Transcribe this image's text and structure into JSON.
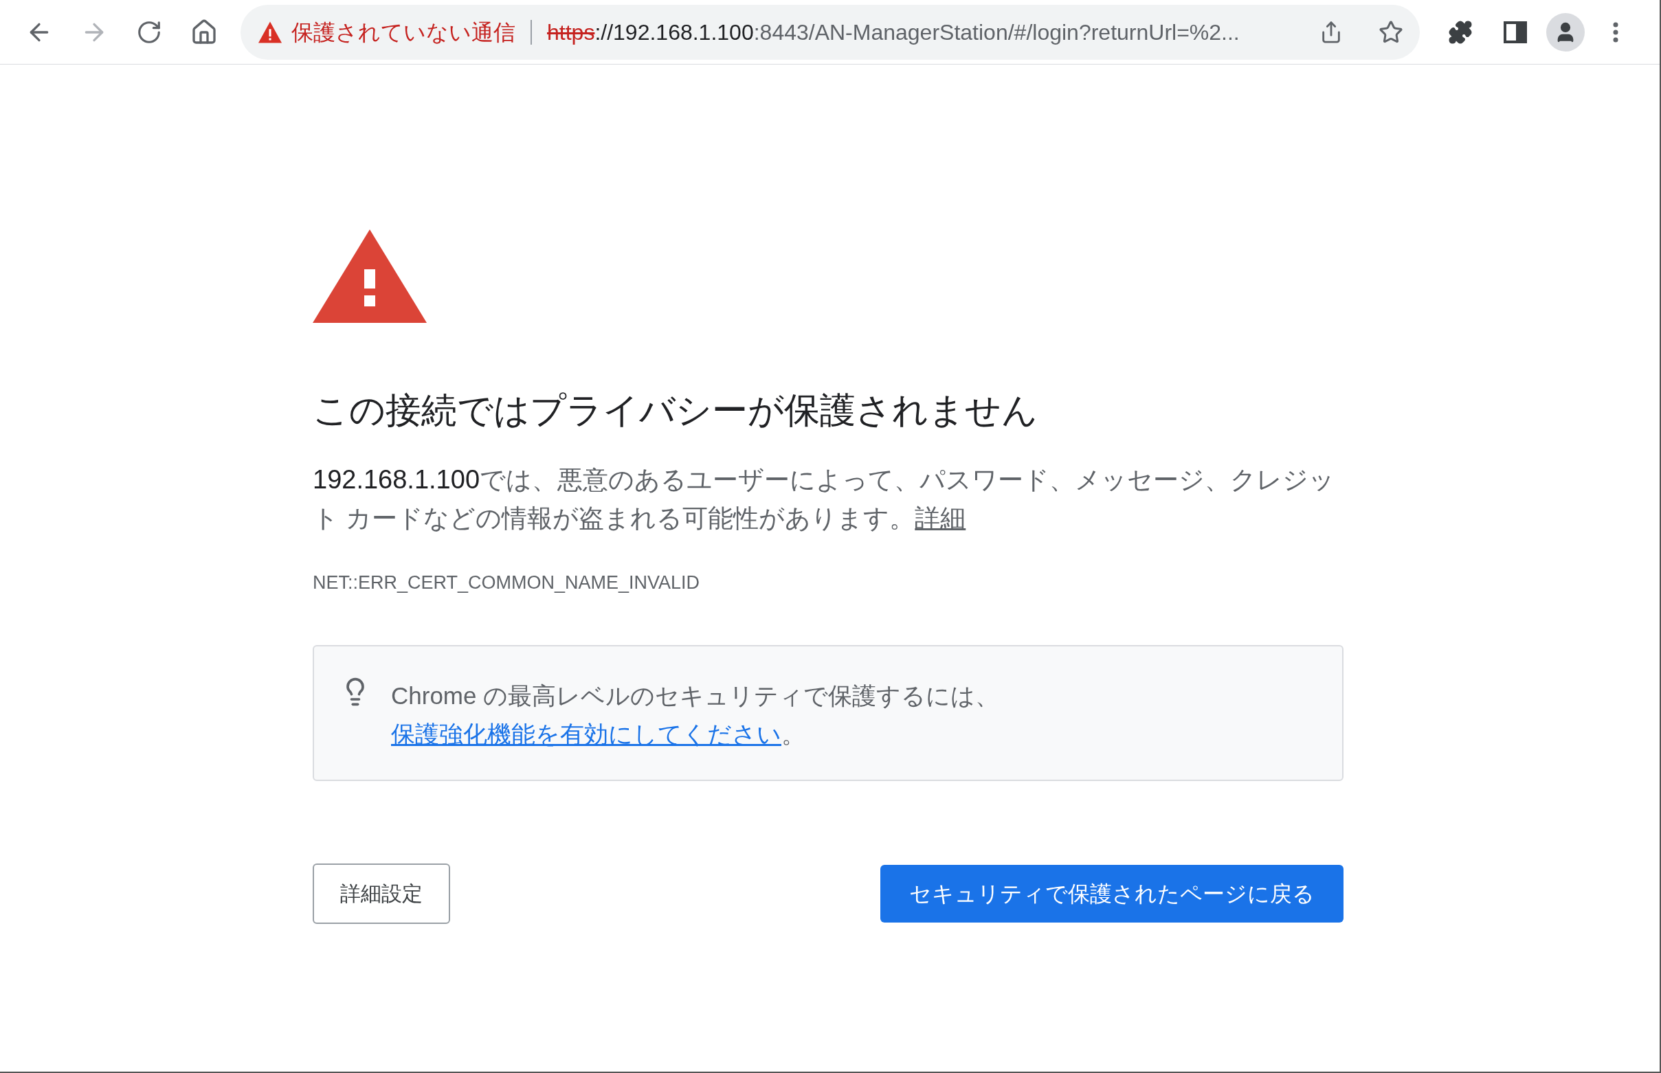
{
  "toolbar": {
    "security_label": "保護されていない通信",
    "url": {
      "scheme": "https",
      "host": "://192.168.1.100",
      "rest": ":8443/AN-ManagerStation/#/login?returnUrl=%2..."
    }
  },
  "page": {
    "heading": "この接続ではプライバシーが保護されません",
    "message": {
      "host": "192.168.1.100",
      "text": "では、悪意のあるユーザーによって、パスワード、メッセージ、クレジット カードなどの情報が盗まれる可能性があります。",
      "link": "詳細"
    },
    "error_code": "NET::ERR_CERT_COMMON_NAME_INVALID",
    "tip": {
      "text": "Chrome の最高レベルのセキュリティで保護するには、",
      "link": "保護強化機能を有効にしてください",
      "end": "。"
    },
    "buttons": [
      {
        "label": "詳細設定",
        "kind": "secondary"
      },
      {
        "label": "セキュリティで保護されたページに戻る",
        "kind": "primary"
      }
    ]
  }
}
